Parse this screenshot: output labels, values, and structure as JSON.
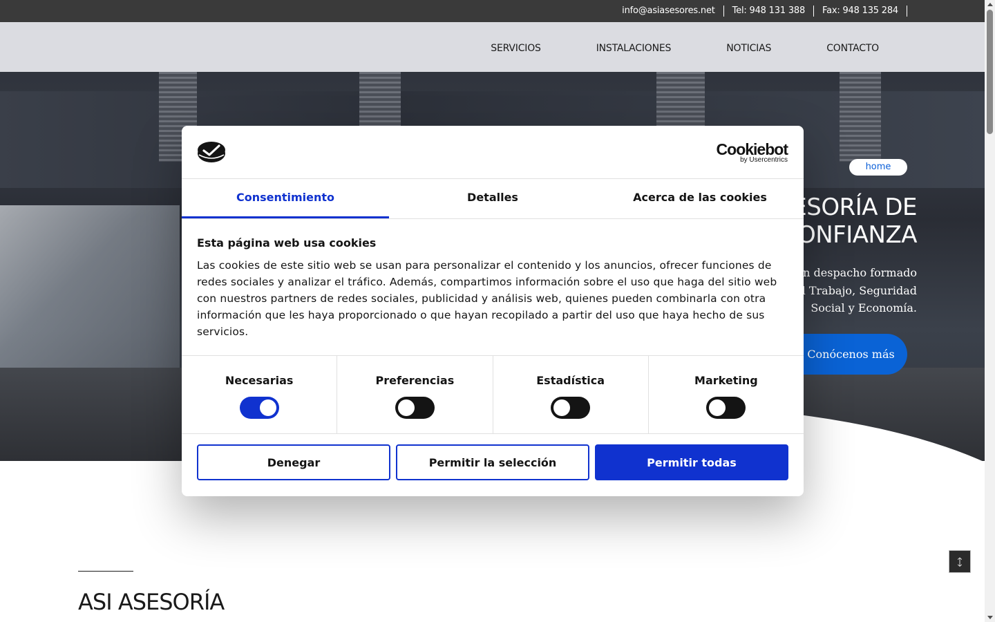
{
  "topbar": {
    "email": "info@asiasesores.net",
    "tel": "Tel: 948 131 388",
    "fax": "Fax: 948 135 284"
  },
  "nav": {
    "items": [
      {
        "label": "SERVICIOS"
      },
      {
        "label": "INSTALACIONES"
      },
      {
        "label": "NOTICIAS"
      },
      {
        "label": "CONTACTO"
      }
    ]
  },
  "hero": {
    "badge": "home",
    "title_line1": "ESORÍA DE",
    "title_line2": "ONFIANZA",
    "text_line1": "n despacho formado",
    "text_line2": "el Trabajo, Seguridad",
    "text_line3": "Social y Economía.",
    "cta": "Conócenos más"
  },
  "section": {
    "title": "ASI ASESORÍA"
  },
  "cookie_dialog": {
    "brand": "Cookiebot",
    "brand_sub": "by Usercentrics",
    "tabs": [
      {
        "label": "Consentimiento",
        "active": true
      },
      {
        "label": "Detalles",
        "active": false
      },
      {
        "label": "Acerca de las cookies",
        "active": false
      }
    ],
    "heading": "Esta página web usa cookies",
    "body": "Las cookies de este sitio web se usan para personalizar el contenido y los anuncios, ofrecer funciones de redes sociales y analizar el tráfico. Además, compartimos información sobre el uso que haga del sitio web con nuestros partners de redes sociales, publicidad y análisis web, quienes pueden combinarla con otra información que les haya proporcionado o que hayan recopilado a partir del uso que haya hecho de sus servicios.",
    "categories": [
      {
        "label": "Necesarias",
        "enabled": true
      },
      {
        "label": "Preferencias",
        "enabled": false
      },
      {
        "label": "Estadística",
        "enabled": false
      },
      {
        "label": "Marketing",
        "enabled": false
      }
    ],
    "buttons": {
      "deny": "Denegar",
      "allow_selection": "Permitir la selección",
      "allow_all": "Permitir todas"
    },
    "accent_color": "#1032cf"
  },
  "icons": {
    "back_to_top": "arrow-up-icon",
    "logo": "cookiebot-logo-icon"
  }
}
